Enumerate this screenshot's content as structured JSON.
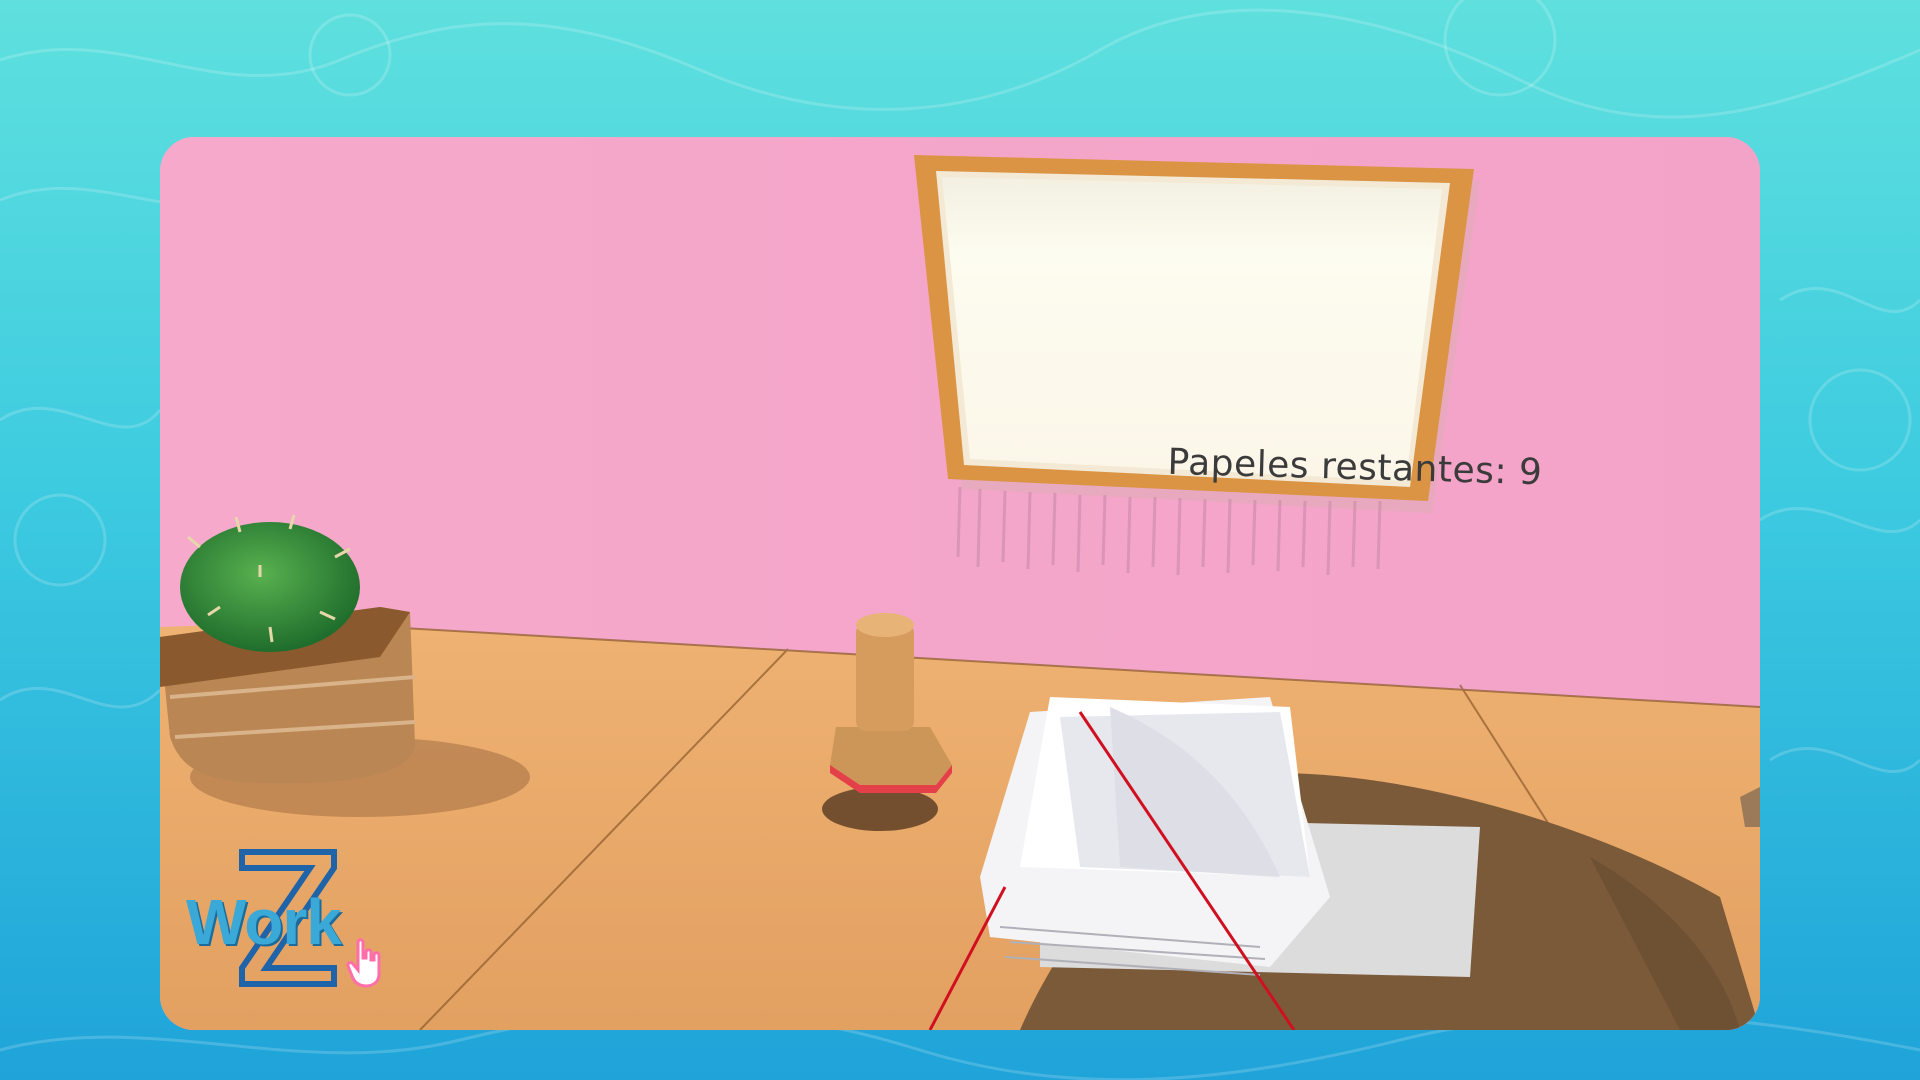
{
  "scene": {
    "counter_text": "Papeles restantes: 9"
  },
  "logo": {
    "text": "Work",
    "letter": "Z"
  },
  "icons": {
    "cursor": "hand-pointer-icon"
  },
  "colors": {
    "background_water": "#3dcbe0",
    "wall": "#f4a6c9",
    "desk": "#e8a866",
    "board_frame": "#d9913f",
    "board_paper": "#fbf8ec",
    "cactus": "#2f8a3a",
    "laser": "#d01020",
    "logo_blue": "#3aa9d8",
    "cursor_pink": "#ff6ea8"
  }
}
